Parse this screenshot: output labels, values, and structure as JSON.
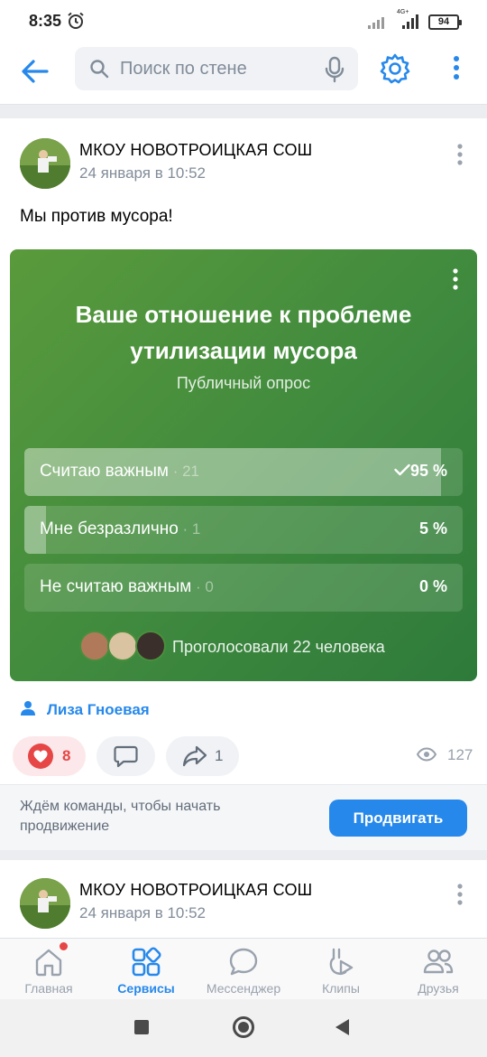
{
  "status_bar": {
    "time": "8:35",
    "network": "4G+",
    "battery": "94"
  },
  "header": {
    "search_placeholder": "Поиск по стене"
  },
  "posts": [
    {
      "author": "МКОУ НОВОТРОИЦКАЯ СОШ",
      "date": "24 января в 10:52",
      "text": "Мы против мусора!",
      "poll": {
        "title": "Ваше отношение к проблеме утилизации мусора",
        "type": "Публичный опрос",
        "options": [
          {
            "label": "Считаю важным",
            "count": " · 21",
            "percent": "95 %",
            "fraction": 0.95,
            "voted": true
          },
          {
            "label": "Мне безразлично",
            "count": " · 1",
            "percent": "5 %",
            "fraction": 0.05,
            "voted": false
          },
          {
            "label": "Не считаю важным",
            "count": " · 0",
            "percent": "0 %",
            "fraction": 0.0,
            "voted": false
          }
        ],
        "voters_text": "Проголосовали 22 человека"
      },
      "signer": "Лиза Гноевая",
      "likes": "8",
      "shares": "1",
      "views": "127",
      "promo_text": "Ждём команды, чтобы начать продвижение",
      "promo_button": "Продвигать"
    },
    {
      "author": "МКОУ НОВОТРОИЦКАЯ СОШ",
      "date": "24 января в 10:52"
    }
  ],
  "tabbar": [
    {
      "label": "Главная",
      "icon": "home-icon"
    },
    {
      "label": "Сервисы",
      "icon": "services-icon"
    },
    {
      "label": "Мессенджер",
      "icon": "messenger-icon"
    },
    {
      "label": "Клипы",
      "icon": "clips-icon"
    },
    {
      "label": "Друзья",
      "icon": "friends-icon"
    }
  ],
  "colors": {
    "accent": "#2688eb",
    "like": "#e64646",
    "poll_start": "#5a9a3c",
    "poll_end": "#2e7a3a"
  }
}
